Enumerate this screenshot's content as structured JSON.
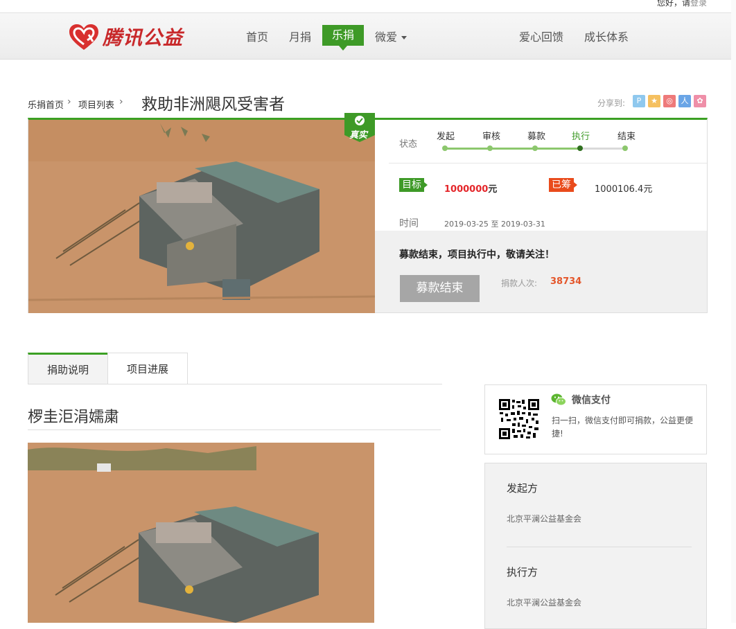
{
  "top": {
    "greeting": "您好，请",
    "login": "登录"
  },
  "brand": {
    "name": "腾讯公益"
  },
  "nav": {
    "home": "首页",
    "monthly": "月捐",
    "lejuan": "乐捐",
    "weiai": "微爱",
    "feedback": "爱心回馈",
    "growth": "成长体系"
  },
  "breadcrumb": {
    "home": "乐捐首页",
    "list": "项目列表"
  },
  "project": {
    "title": "救助非洲飓风受害者",
    "badge": "真实",
    "share_label": "分享到:",
    "status_label": "状态",
    "steps": [
      "发起",
      "审核",
      "募款",
      "执行",
      "结束"
    ],
    "current_step": "执行",
    "goal_tag": "目标",
    "goal_value": "1000000",
    "unit": "元",
    "raised_tag": "已筹",
    "raised_value": "1000106.4",
    "time_label": "时间",
    "start_date": "2019-03-25",
    "to": "至",
    "end_date": "2019-03-31",
    "notice": "募款结束，项目执行中，敬请关注！",
    "button": "募款结束",
    "donors_label": "捐款人次:",
    "donors_value": "38734",
    "accent_green": "#3e9a27",
    "accent_red": "#e4262a"
  },
  "tabs": {
    "description": "捐助说明",
    "progress": "项目进展"
  },
  "section": {
    "title": "椤圭洰涓嬬粛"
  },
  "wechat": {
    "title": "微信支付",
    "desc": "扫一扫，微信支付即可捐款，公益更便捷!"
  },
  "org": {
    "initiator_label": "发起方",
    "initiator": "北京平澜公益基金会",
    "executor_label": "执行方",
    "executor": "北京平澜公益基金会"
  }
}
